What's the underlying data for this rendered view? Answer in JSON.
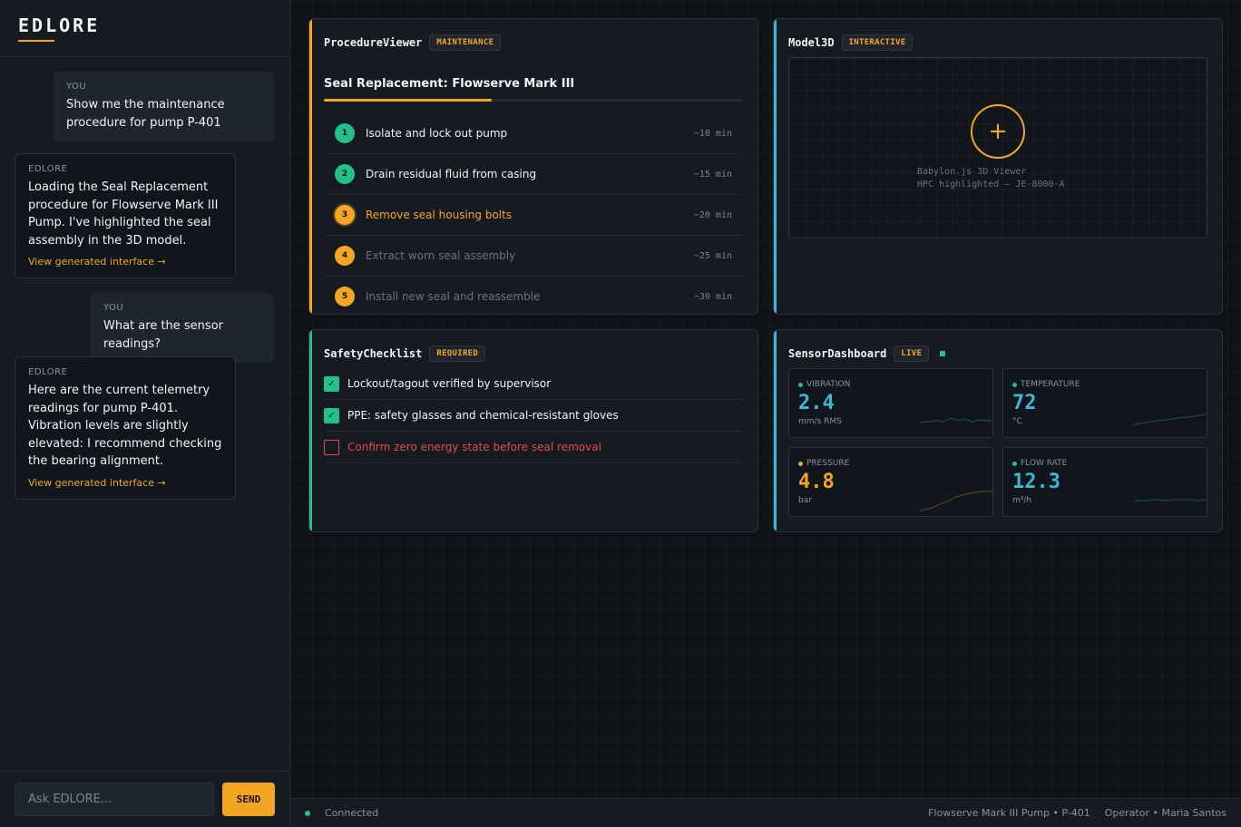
{
  "colors": {
    "accent": "#f5a524",
    "success": "#22c08a",
    "danger": "#e5484d",
    "info": "#3db8d4",
    "muted": "#6b737d"
  },
  "app": {
    "brand": "EDLORE"
  },
  "chat": {
    "messages": [
      {
        "role": "YOU",
        "text": "Show me the maintenance procedure for pump P-401"
      },
      {
        "role": "EDLORE",
        "text": "Loading the Seal Replacement procedure for Flowserve Mark III Pump. I've highlighted the seal assembly in the 3D model.",
        "link": "View generated interface →"
      },
      {
        "role": "YOU",
        "text": "What are the sensor readings?"
      },
      {
        "role": "EDLORE",
        "text": "Here are the current telemetry readings for pump P-401. Vibration levels are slightly elevated: I recommend checking the bearing alignment.",
        "link": "View generated interface →"
      }
    ],
    "input_placeholder": "Ask EDLORE...",
    "send_label": "SEND"
  },
  "procedure": {
    "title": "ProcedureViewer",
    "tag": "MAINTENANCE",
    "heading": "Seal Replacement: Flowserve Mark III",
    "progress": 0.4,
    "steps": [
      {
        "num": "1",
        "label": "Isolate and lock out pump",
        "duration": "~10 min",
        "state": "done"
      },
      {
        "num": "2",
        "label": "Drain residual fluid from casing",
        "duration": "~15 min",
        "state": "done"
      },
      {
        "num": "3",
        "label": "Remove seal housing bolts",
        "duration": "~20 min",
        "state": "active"
      },
      {
        "num": "4",
        "label": "Extract worn seal assembly",
        "duration": "~25 min",
        "state": "pending"
      },
      {
        "num": "5",
        "label": "Install new seal and reassemble",
        "duration": "~30 min",
        "state": "pending"
      }
    ]
  },
  "model3d": {
    "title": "Model3D",
    "tag": "INTERACTIVE",
    "plus_icon": "+",
    "line1": "Babylon.js 3D Viewer",
    "line2": "HPC highlighted — JE-8000-A"
  },
  "safety": {
    "title": "SafetyChecklist",
    "tag": "REQUIRED",
    "items": [
      {
        "label": "Lockout/tagout verified by supervisor",
        "checked": true
      },
      {
        "label": "PPE: safety glasses and chemical-resistant gloves",
        "checked": true
      },
      {
        "label": "Confirm zero energy state before seal removal",
        "checked": false
      }
    ]
  },
  "sensors": {
    "title": "SensorDashboard",
    "tag": "LIVE",
    "items": [
      {
        "label": "VIBRATION",
        "value": "2.4",
        "unit": "mm/s RMS",
        "color": "#3db8d4",
        "dot": "#22c08a"
      },
      {
        "label": "TEMPERATURE",
        "value": "72",
        "unit": "°C",
        "color": "#3db8d4",
        "dot": "#22c08a"
      },
      {
        "label": "PRESSURE",
        "value": "4.8",
        "unit": "bar",
        "color": "#f5a524",
        "dot": "#f5a524"
      },
      {
        "label": "FLOW RATE",
        "value": "12.3",
        "unit": "m³/h",
        "color": "#3db8d4",
        "dot": "#22c08a"
      }
    ]
  },
  "status": {
    "connection": "Connected",
    "device": "Flowserve Mark III Pump • P-401",
    "operator": "Operator • Maria Santos"
  }
}
